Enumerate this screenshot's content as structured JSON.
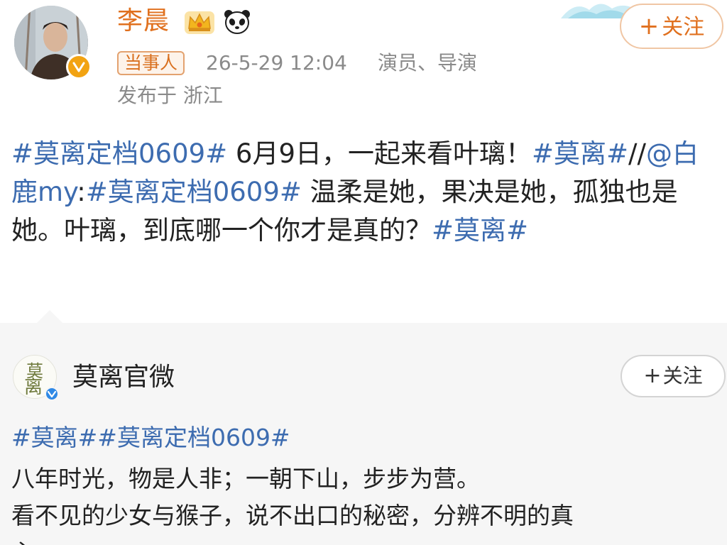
{
  "post": {
    "author": "李晨",
    "author_tag": "当事人",
    "time": "26-5-29 12:04",
    "role": "演员、导演",
    "location": "发布于 浙江",
    "follow_label": "关注",
    "follow_plus": "+",
    "text": {
      "hashtag1": "#莫离定档0609#",
      "body1": " 6月9日，一起来看叶璃！",
      "hashtag2": "#莫离#",
      "body2": "//",
      "mention": "@白鹿my",
      "body3": ":",
      "hashtag3": "#莫离定档0609#",
      "body4": " 温柔是她，果决是她，孤独也是她。叶璃，到底哪一个你才是真的？",
      "hashtag4": "#莫离#"
    }
  },
  "repost": {
    "author": "莫离官微",
    "avatar_text_1": "莫",
    "avatar_text_2": "离",
    "follow_label": "关注",
    "follow_plus": "+",
    "tags": "#莫离##莫离定档0609#",
    "line1": "八年时光，物是人非；一朝下山，步步为营。",
    "line2": "看不见的少女与猴子，说不出口的秘密，分辨不明的真",
    "line3": "心。"
  },
  "colors": {
    "name_orange": "#e0701e",
    "link_blue": "#3d6cb0",
    "meta_gray": "#8a8a8a",
    "repost_bg": "#f6f6f6"
  },
  "icons": {
    "verified": "verified-badge-icon",
    "crown": "crown-icon",
    "panda": "panda-icon"
  }
}
